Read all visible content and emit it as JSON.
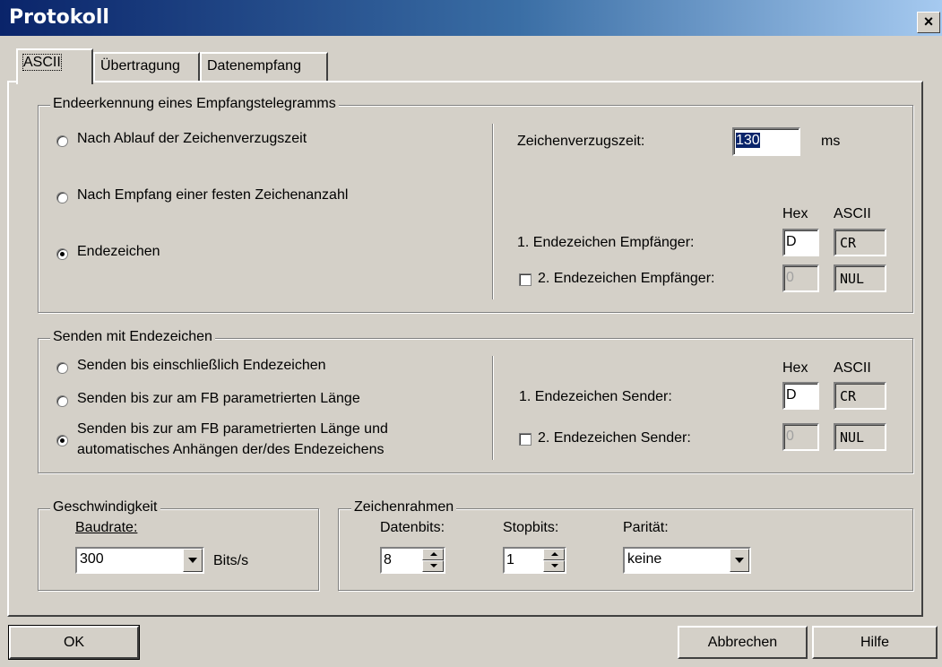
{
  "window": {
    "title": "Protokoll",
    "close": "×"
  },
  "tabs": [
    {
      "label": "ASCII",
      "active": true
    },
    {
      "label": "Übertragung"
    },
    {
      "label": "Datenempfang"
    }
  ],
  "end_detection": {
    "legend": "Endeerkennung eines Empfangstelegramms",
    "opt1": "Nach Ablauf der Zeichenverzugszeit",
    "opt2": "Nach Empfang einer festen Zeichenanzahl",
    "opt3": "Endezeichen",
    "delay_label": "Zeichenverzugszeit:",
    "delay_value": "130",
    "delay_unit": "ms",
    "hex_header": "Hex",
    "ascii_header": "ASCII",
    "end1_label": "1. Endezeichen Empfänger:",
    "end1_hex": "D",
    "end1_ascii": "CR",
    "end2_label": "2. Endezeichen Empfänger:",
    "end2_hex": "0",
    "end2_ascii": "NUL"
  },
  "send": {
    "legend": "Senden mit Endezeichen",
    "opt1": "Senden bis einschließlich Endezeichen",
    "opt2": "Senden bis zur am FB parametrierten Länge",
    "opt3_line1": "Senden bis zur am FB parametrierten Länge und",
    "opt3_line2": "automatisches Anhängen der/des Endezeichens",
    "hex_header": "Hex",
    "ascii_header": "ASCII",
    "end1_label": "1. Endezeichen Sender:",
    "end1_hex": "D",
    "end1_ascii": "CR",
    "end2_label": "2. Endezeichen Sender:",
    "end2_hex": "0",
    "end2_ascii": "NUL"
  },
  "speed": {
    "legend": "Geschwindigkeit",
    "baud_label": "Baudrate:",
    "baud_value": "300",
    "unit": "Bits/s"
  },
  "frame": {
    "legend": "Zeichenrahmen",
    "databits_label": "Datenbits:",
    "databits_value": "8",
    "stopbits_label": "Stopbits:",
    "stopbits_value": "1",
    "parity_label": "Parität:",
    "parity_value": "keine"
  },
  "buttons": {
    "ok": "OK",
    "cancel": "Abbrechen",
    "help": "Hilfe"
  },
  "colors": {
    "titlebar_start": "#0a246a",
    "titlebar_end": "#a6caf0",
    "dialog_bg": "#d4d0c8"
  }
}
